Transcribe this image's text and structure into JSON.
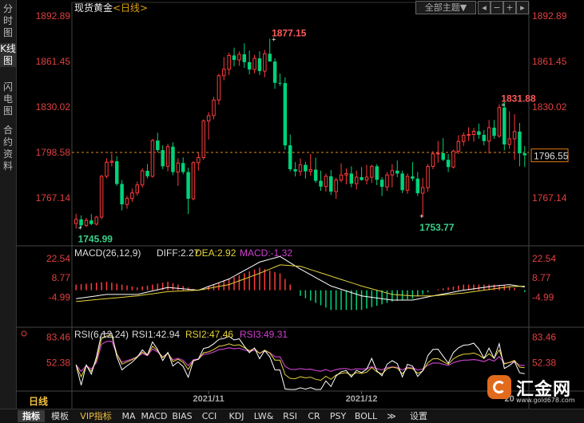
{
  "left_tabs": [
    {
      "label": "分时图",
      "active": false
    },
    {
      "label": "K线图",
      "active": true
    },
    {
      "label": "闪电图",
      "active": false
    },
    {
      "label": "合约资料",
      "active": false
    }
  ],
  "toolbar": {
    "theme_label": "全部主题▼"
  },
  "period_label": "日线",
  "bottom_tabs": [
    "指标",
    "模板",
    "VIP指标",
    "MA",
    "MACD",
    "BIAS",
    "CCI",
    "KDJ",
    "LW&",
    "RSI",
    "CR",
    "PSY",
    "BOLL",
    "≫",
    "设置"
  ],
  "watermark": {
    "name": "汇金网",
    "url": "www.gold678.com"
  },
  "chart_data": {
    "type": "candlestick",
    "title": "现货黄金",
    "period": "日线",
    "y_ticks": [
      1892.89,
      1861.45,
      1830.02,
      1798.58,
      1767.14
    ],
    "ylim": [
      1736,
      1893.5
    ],
    "ref_price": 1798.58,
    "current_price": 1796.55,
    "x_ticks": [
      {
        "label": "2021/11",
        "index": 26
      },
      {
        "label": "2021/12",
        "index": 56
      },
      {
        "label": "20",
        "index": 85
      }
    ],
    "annotations": [
      {
        "text": "1877.15",
        "index": 39,
        "price": 1877.15,
        "kind": "high"
      },
      {
        "text": "1745.99",
        "index": 1,
        "price": 1745.99,
        "kind": "low"
      },
      {
        "text": "1831.88",
        "index": 84,
        "price": 1831.88,
        "kind": "high"
      },
      {
        "text": "1753.77",
        "index": 68,
        "price": 1753.77,
        "kind": "low"
      }
    ],
    "candles": [
      [
        1749.5,
        1756.2,
        1745.99,
        1752.3
      ],
      [
        1752.3,
        1755.1,
        1746.5,
        1748.2
      ],
      [
        1748.2,
        1753.4,
        1747.0,
        1751.6
      ],
      [
        1751.6,
        1756.0,
        1748.3,
        1749.1
      ],
      [
        1749.1,
        1754.8,
        1748.0,
        1753.9
      ],
      [
        1753.9,
        1783.0,
        1752.5,
        1782.1
      ],
      [
        1782.1,
        1794.5,
        1780.8,
        1791.8
      ],
      [
        1791.8,
        1797.8,
        1789.0,
        1792.5
      ],
      [
        1792.5,
        1796.0,
        1775.5,
        1776.8
      ],
      [
        1776.8,
        1779.5,
        1758.5,
        1762.7
      ],
      [
        1762.7,
        1768.5,
        1759.7,
        1766.8
      ],
      [
        1766.8,
        1773.6,
        1764.5,
        1770.6
      ],
      [
        1770.6,
        1778.4,
        1768.7,
        1776.1
      ],
      [
        1776.1,
        1787.5,
        1774.2,
        1785.9
      ],
      [
        1785.9,
        1790.6,
        1780.6,
        1782.1
      ],
      [
        1782.1,
        1808.0,
        1781.2,
        1806.8
      ],
      [
        1806.8,
        1812.2,
        1798.7,
        1800.2
      ],
      [
        1800.2,
        1803.5,
        1787.0,
        1789.0
      ],
      [
        1789.0,
        1804.5,
        1785.5,
        1802.6
      ],
      [
        1802.6,
        1805.6,
        1782.8,
        1785.0
      ],
      [
        1785.0,
        1794.5,
        1775.5,
        1791.3
      ],
      [
        1791.3,
        1795.2,
        1783.5,
        1785.0
      ],
      [
        1785.0,
        1788.0,
        1756.0,
        1766.6
      ],
      [
        1766.6,
        1792.5,
        1765.5,
        1791.5
      ],
      [
        1791.5,
        1798.5,
        1786.0,
        1795.0
      ],
      [
        1795.0,
        1821.5,
        1793.6,
        1820.3
      ],
      [
        1820.3,
        1826.5,
        1807.5,
        1824.0
      ],
      [
        1824.0,
        1837.0,
        1821.5,
        1834.8
      ],
      [
        1834.8,
        1853.0,
        1831.6,
        1851.6
      ],
      [
        1851.6,
        1864.5,
        1848.5,
        1856.1
      ],
      [
        1856.1,
        1867.5,
        1852.0,
        1865.6
      ],
      [
        1865.6,
        1871.0,
        1858.0,
        1862.5
      ],
      [
        1862.5,
        1868.5,
        1858.5,
        1866.4
      ],
      [
        1866.4,
        1874.0,
        1857.0,
        1861.0
      ],
      [
        1861.0,
        1869.0,
        1852.5,
        1855.9
      ],
      [
        1855.9,
        1866.0,
        1853.3,
        1863.6
      ],
      [
        1863.6,
        1868.5,
        1852.0,
        1854.8
      ],
      [
        1854.8,
        1869.5,
        1850.5,
        1866.8
      ],
      [
        1866.8,
        1877.15,
        1863.0,
        1861.4
      ],
      [
        1861.4,
        1863.5,
        1842.5,
        1846.7
      ],
      [
        1846.7,
        1853.0,
        1844.5,
        1846.5
      ],
      [
        1846.5,
        1850.5,
        1800.5,
        1803.5
      ],
      [
        1803.5,
        1811.0,
        1785.5,
        1787.0
      ],
      [
        1787.0,
        1792.0,
        1782.0,
        1785.5
      ],
      [
        1785.5,
        1794.5,
        1782.5,
        1790.0
      ],
      [
        1790.0,
        1792.0,
        1780.5,
        1785.5
      ],
      [
        1785.5,
        1797.5,
        1782.5,
        1786.7
      ],
      [
        1786.7,
        1795.0,
        1777.5,
        1779.0
      ],
      [
        1779.0,
        1786.0,
        1772.0,
        1775.0
      ],
      [
        1775.0,
        1784.0,
        1771.5,
        1782.1
      ],
      [
        1782.1,
        1786.5,
        1769.2,
        1771.5
      ],
      [
        1771.5,
        1781.0,
        1766.5,
        1779.5
      ],
      [
        1779.5,
        1791.0,
        1778.0,
        1783.0
      ],
      [
        1783.0,
        1787.5,
        1776.5,
        1784.0
      ],
      [
        1784.0,
        1789.0,
        1774.5,
        1777.0
      ],
      [
        1777.0,
        1786.0,
        1773.0,
        1781.5
      ],
      [
        1781.5,
        1788.5,
        1779.0,
        1779.5
      ],
      [
        1779.5,
        1790.0,
        1776.5,
        1781.5
      ],
      [
        1781.5,
        1790.0,
        1777.5,
        1789.0
      ],
      [
        1789.0,
        1790.5,
        1776.0,
        1779.7
      ],
      [
        1779.7,
        1781.5,
        1768.5,
        1774.8
      ],
      [
        1774.8,
        1785.0,
        1772.0,
        1783.0
      ],
      [
        1783.0,
        1790.5,
        1774.5,
        1786.0
      ],
      [
        1786.0,
        1793.0,
        1781.5,
        1784.0
      ],
      [
        1784.0,
        1786.0,
        1770.5,
        1772.5
      ],
      [
        1772.5,
        1784.0,
        1770.0,
        1782.0
      ],
      [
        1782.0,
        1792.0,
        1778.8,
        1780.5
      ],
      [
        1780.5,
        1785.0,
        1768.5,
        1770.4
      ],
      [
        1770.4,
        1781.0,
        1753.77,
        1774.3
      ],
      [
        1774.3,
        1790.5,
        1771.5,
        1788.9
      ],
      [
        1788.9,
        1799.5,
        1787.0,
        1797.6
      ],
      [
        1797.6,
        1806.5,
        1791.5,
        1798.1
      ],
      [
        1798.1,
        1808.5,
        1792.5,
        1793.5
      ],
      [
        1793.5,
        1797.5,
        1785.0,
        1788.5
      ],
      [
        1788.5,
        1800.5,
        1787.5,
        1799.5
      ],
      [
        1799.5,
        1810.5,
        1797.5,
        1806.2
      ],
      [
        1806.2,
        1812.5,
        1803.0,
        1810.4
      ],
      [
        1810.4,
        1816.0,
        1806.5,
        1811.0
      ],
      [
        1811.0,
        1815.5,
        1806.0,
        1813.2
      ],
      [
        1813.2,
        1818.5,
        1808.0,
        1810.7
      ],
      [
        1810.7,
        1814.0,
        1803.5,
        1806.4
      ],
      [
        1806.4,
        1821.0,
        1797.8,
        1815.7
      ],
      [
        1815.7,
        1821.0,
        1808.0,
        1810.0
      ],
      [
        1810.0,
        1831.88,
        1808.7,
        1829.6
      ],
      [
        1829.6,
        1833.5,
        1800.0,
        1804.1
      ],
      [
        1804.1,
        1827.0,
        1801.0,
        1808.0
      ],
      [
        1808.0,
        1825.0,
        1793.5,
        1813.0
      ],
      [
        1813.0,
        1819.0,
        1789.0,
        1798.0
      ],
      [
        1798.0,
        1803.0,
        1788.5,
        1796.55
      ]
    ],
    "macd": {
      "params": "MACD(26,12,9)",
      "diff_label": "DIFF:2.27",
      "dea_label": "DEA:2.92",
      "macd_label": "MACD:-1.32",
      "y_ticks": [
        22.54,
        8.77,
        -4.99
      ],
      "ylim": [
        -24,
        27
      ],
      "diff_anchors": [
        [
          0,
          -6
        ],
        [
          6,
          -3
        ],
        [
          12,
          -3
        ],
        [
          18,
          2
        ],
        [
          24,
          0
        ],
        [
          30,
          8
        ],
        [
          36,
          20
        ],
        [
          40,
          24
        ],
        [
          44,
          15
        ],
        [
          50,
          3
        ],
        [
          56,
          -4
        ],
        [
          62,
          -7
        ],
        [
          66,
          -7
        ],
        [
          70,
          -4
        ],
        [
          76,
          0
        ],
        [
          82,
          3
        ],
        [
          85,
          4
        ],
        [
          88,
          2.27
        ]
      ],
      "dea_anchors": [
        [
          0,
          -8
        ],
        [
          6,
          -6
        ],
        [
          12,
          -4
        ],
        [
          18,
          -1
        ],
        [
          24,
          0
        ],
        [
          30,
          4
        ],
        [
          36,
          12
        ],
        [
          40,
          18
        ],
        [
          44,
          17
        ],
        [
          50,
          10
        ],
        [
          56,
          3
        ],
        [
          62,
          -3
        ],
        [
          66,
          -4
        ],
        [
          70,
          -4
        ],
        [
          76,
          -2
        ],
        [
          82,
          1
        ],
        [
          85,
          2.5
        ],
        [
          88,
          2.92
        ]
      ]
    },
    "rsi": {
      "params": "RSI(6,12,24)",
      "rsi1_label": "RSI1:42.94",
      "rsi2_label": "RSI2:47.46",
      "rsi3_label": "RSI3:49.31",
      "y_ticks": [
        83.46,
        52.38
      ],
      "ylim": [
        20,
        88
      ]
    }
  }
}
